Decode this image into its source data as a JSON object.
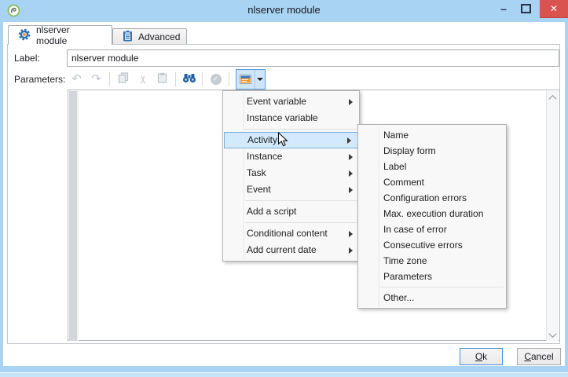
{
  "window": {
    "title": "nlserver module"
  },
  "titlebar": {
    "controls": {
      "minimize": "minimize",
      "maximize": "maximize",
      "close": "close"
    }
  },
  "icons": {
    "undo": "↶",
    "redo": "↷",
    "cut": "✂",
    "check": "✓",
    "close": "✕",
    "minimize": "–",
    "tab1": "gear-icon",
    "tab2": "clipboard-icon",
    "toolbar": [
      "undo-icon",
      "redo-icon",
      "copy-icon",
      "cut-icon",
      "paste-icon",
      "binoculars-icon",
      "check-circle-icon",
      "insert-field-icon"
    ]
  },
  "tabs": [
    {
      "label": "nlserver module",
      "active": true
    },
    {
      "label": "Advanced",
      "active": false
    }
  ],
  "form": {
    "label_caption": "Label:",
    "label_value": "nlserver module",
    "parameters_caption": "Parameters:"
  },
  "toolbar": {
    "buttons": [
      {
        "name": "undo",
        "enabled": false
      },
      {
        "name": "redo",
        "enabled": false
      },
      {
        "name": "copy",
        "enabled": false
      },
      {
        "name": "cut",
        "enabled": false
      },
      {
        "name": "paste",
        "enabled": false
      },
      {
        "name": "find",
        "enabled": true
      },
      {
        "name": "validate",
        "enabled": false
      },
      {
        "name": "insert-variable",
        "enabled": true,
        "pressed": true
      }
    ]
  },
  "menu": {
    "items": [
      {
        "label": "Event variable",
        "submenu": true
      },
      {
        "label": "Instance variable",
        "submenu": false
      },
      {
        "label": "Activity",
        "submenu": true,
        "highlighted": true
      },
      {
        "label": "Instance",
        "submenu": true
      },
      {
        "label": "Task",
        "submenu": true
      },
      {
        "label": "Event",
        "submenu": true
      },
      {
        "label": "Add a script",
        "submenu": false
      },
      {
        "label": "Conditional content",
        "submenu": true
      },
      {
        "label": "Add current date",
        "submenu": true
      }
    ]
  },
  "submenu": {
    "items": [
      "Name",
      "Display form",
      "Label",
      "Comment",
      "Configuration errors",
      "Max. execution duration",
      "In case of error",
      "Consecutive errors",
      "Time zone",
      "Parameters",
      "Other..."
    ]
  },
  "footer": {
    "ok_label": "Ok",
    "cancel_label": "Cancel"
  },
  "colors": {
    "accent": "#a9d3f2",
    "close_red": "#d9534f",
    "menu_highlight_bg": "#d3e9fc",
    "menu_highlight_border": "#7ab0e0",
    "enabled_icon_blue": "#1d5fa0",
    "field_icon_orange": "#f59b2d",
    "field_icon_blue": "#3d74c0"
  }
}
